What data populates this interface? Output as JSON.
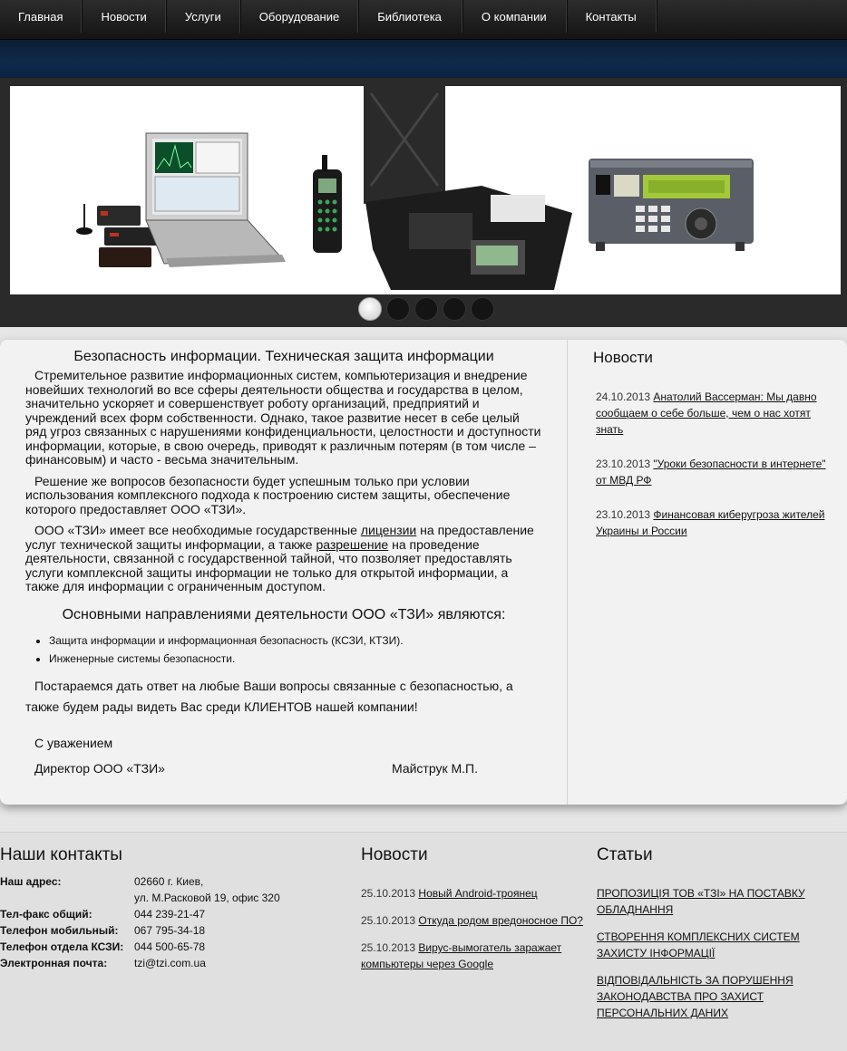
{
  "nav": {
    "items": [
      {
        "label": "Главная"
      },
      {
        "label": "Новости"
      },
      {
        "label": "Услуги"
      },
      {
        "label": "Оборудование"
      },
      {
        "label": "Библиотека"
      },
      {
        "label": "О компании"
      },
      {
        "label": "Контакты"
      }
    ]
  },
  "slider": {
    "slides_count": 5,
    "active_index": 0
  },
  "main": {
    "title": "Безопасность информации. Техническая защита информации",
    "paragraph1": "Стремительное развитие информационных систем, компьютеризация и внедрение новейших технологий во все сферы деятельности общества и государства в целом, значительно ускоряет и совершенствует роботу организаций, предприятий и учреждений всех форм собственности. Однако, такое развитие несет в себе целый ряд угроз связанных с нарушениями конфиденциальности, целостности и доступности информации, которые, в свою очередь, приводят к различным потерям (в том числе – финансовым) и часто - весьма значительным.",
    "paragraph2": "Решение же вопросов безопасности будет успешным только при условии использования комплексного подхода к построению систем защиты, обеспечение которого предоставляет ООО «ТЗИ».",
    "paragraph3_a": "ООО «ТЗИ» имеет все необходимые государственные ",
    "paragraph3_link1": "лицензии",
    "paragraph3_b": " на предоставление услуг технической защиты информации, а также ",
    "paragraph3_link2": "разрешение",
    "paragraph3_c": " на проведение деятельности, связанной с государственной тайной, что позволяет предоставлять услуги комплексной защиты информации не только для открытой информации, а также для информации с ограниченным доступом.",
    "directions_title": "Основными направлениями деятельности ООО «ТЗИ» являются:",
    "directions": [
      "Защита информации и информационная безопасность (КСЗИ, КТЗИ).",
      "Инженерные системы безопасности."
    ],
    "closing": "Постараемся дать ответ на любые Ваши вопросы связанные с безопасностью, а также будем рады видеть Вас среди КЛИЕНТОВ нашей компании!",
    "regards": "С уважением",
    "director": "Директор ООО «ТЗИ»",
    "director_name": "Майструк М.П."
  },
  "sidebar": {
    "title": "Новости",
    "news": [
      {
        "date": "24.10.2013",
        "text": "Анатолий Вассерман: Мы давно сообщаем о себе больше, чем о нас хотят знать"
      },
      {
        "date": "23.10.2013",
        "text": "\"Уроки безопасности в интернете\" от МВД РФ"
      },
      {
        "date": "23.10.2013",
        "text": "Финансовая киберугроза жителей Украины и России"
      }
    ]
  },
  "footer": {
    "contacts_title": "Наши контакты",
    "contacts": [
      {
        "label": "Наш адрес:",
        "value": "02660 г. Киев,"
      },
      {
        "label": "",
        "value": "ул. М.Расковой 19, офис 320"
      },
      {
        "label": "Тел-факс общий:",
        "value": "044 239-21-47"
      },
      {
        "label": "Телефон мобильный:",
        "value": "067 795-34-18"
      },
      {
        "label": "Телефон отдела КСЗИ:",
        "value": "044 500-65-78"
      },
      {
        "label": "Электронная почта:",
        "value": "tzi@tzi.com.ua"
      }
    ],
    "news_title": "Новости",
    "news": [
      {
        "date": "25.10.2013",
        "text": "Новый Android-троянец"
      },
      {
        "date": "25.10.2013",
        "text": "Откуда родом вредоносное ПО?"
      },
      {
        "date": "25.10.2013",
        "text": "Вирус-вымогатель заражает компьютеры через Google"
      }
    ],
    "articles_title": "Статьи",
    "articles": [
      {
        "text": "ПРОПОЗИЦІЯ ТОВ «ТЗІ» НА ПОСТАВКУ ОБЛАДНАННЯ"
      },
      {
        "text": "СТВОРЕННЯ КОМПЛЕКСНИХ СИСТЕМ ЗАХИСТУ ІНФОРМАЦІЇ"
      },
      {
        "text": "ВІДПОВІДАЛЬНІСТЬ ЗА ПОРУШЕННЯ ЗАКОНОДАВСТВА ПРО ЗАХИСТ ПЕРСОНАЛЬНИХ ДАНИХ"
      }
    ]
  },
  "colors": {
    "nav_bg": "#1e1e1e",
    "band_blue": "#0f2a4c",
    "panel_bg": "#f2f2f2",
    "footer_bg": "#e0e0e0"
  }
}
